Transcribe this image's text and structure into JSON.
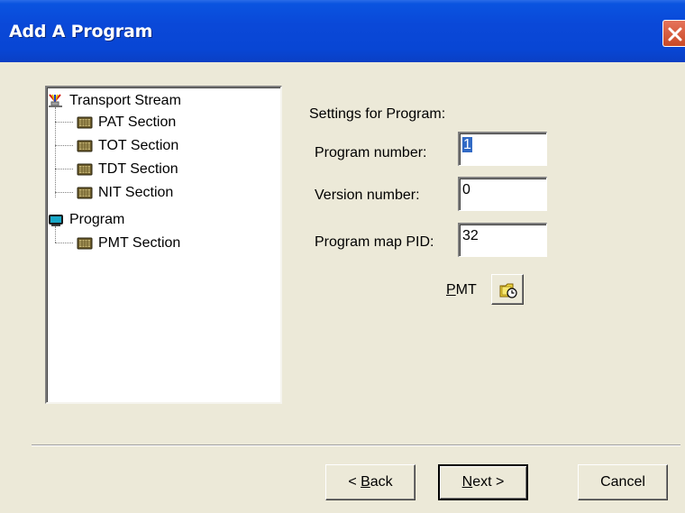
{
  "window": {
    "title": "Add A Program"
  },
  "tree": {
    "root": {
      "label": "Transport Stream",
      "icon": "transport-stream-icon",
      "children": [
        "PAT Section",
        "TOT Section",
        "TDT Section",
        "NIT Section"
      ]
    },
    "program": {
      "label": "Program",
      "icon": "program-icon",
      "children": [
        "PMT Section"
      ]
    }
  },
  "settings": {
    "heading": "Settings for Program:",
    "program_number_label": "Program number:",
    "program_number_value": "1",
    "version_number_label": "Version number:",
    "version_number_value": "0",
    "program_map_pid_label": "Program map PID:",
    "program_map_pid_value": "32",
    "pmt_label_underlined": "P",
    "pmt_label_rest": "MT"
  },
  "buttons": {
    "back_prefix": "< ",
    "back_underlined": "B",
    "back_rest": "ack",
    "next_underlined": "N",
    "next_rest": "ext >",
    "cancel": "Cancel"
  }
}
